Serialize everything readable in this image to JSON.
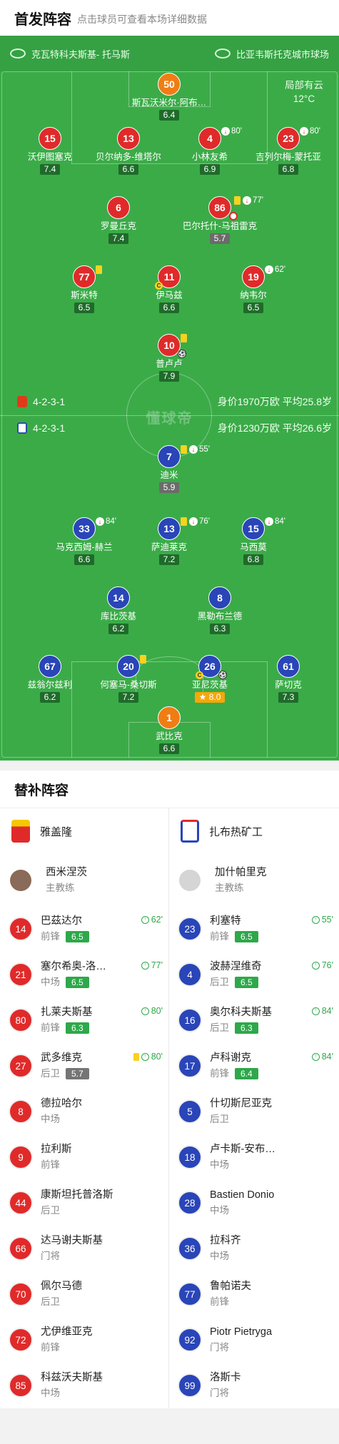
{
  "header": {
    "title": "首发阵容",
    "subtitle": "点击球员可查看本场详细数据"
  },
  "venue": {
    "home_stadium": "克瓦特科夫斯基- 托马斯",
    "away_stadium": "比亚韦斯托克城市球场"
  },
  "weather": {
    "condition": "局部有云",
    "temp": "12°C"
  },
  "watermark": "懂球帝",
  "home_team": {
    "formation": "4-2-3-1",
    "value": "身价1970万欧 平均25.8岁",
    "color": "#e02a2a"
  },
  "away_team": {
    "formation": "4-2-3-1",
    "value": "身价1230万欧 平均26.6岁",
    "color": "#2945b8"
  },
  "home_players": [
    {
      "num": "50",
      "name": "斯瓦沃米尔·阿布…",
      "rating": "6.4"
    },
    {
      "num": "15",
      "name": "沃伊图塞克",
      "rating": "7.4"
    },
    {
      "num": "13",
      "name": "贝尔纳多-维塔尔",
      "rating": "6.6"
    },
    {
      "num": "4",
      "name": "小林友希",
      "rating": "6.9",
      "sub": "80'"
    },
    {
      "num": "23",
      "name": "吉列尔梅-蒙托亚",
      "rating": "6.8",
      "sub": "80'"
    },
    {
      "num": "6",
      "name": "罗曼丘克",
      "rating": "7.4"
    },
    {
      "num": "86",
      "name": "巴尔托什-马祖雷克",
      "rating": "5.7",
      "sub": "77'"
    },
    {
      "num": "77",
      "name": "斯米特",
      "rating": "6.5"
    },
    {
      "num": "11",
      "name": "伊马兹",
      "rating": "6.6"
    },
    {
      "num": "19",
      "name": "纳韦尔",
      "rating": "6.5",
      "sub": "62'"
    },
    {
      "num": "10",
      "name": "普卢卢",
      "rating": "7.9"
    }
  ],
  "away_players": [
    {
      "num": "7",
      "name": "迪米",
      "rating": "5.9",
      "sub": "55'"
    },
    {
      "num": "33",
      "name": "马克西姆-赫兰",
      "rating": "6.6",
      "sub": "84'"
    },
    {
      "num": "13",
      "name": "萨迪莱克",
      "rating": "7.2",
      "sub": "76'"
    },
    {
      "num": "15",
      "name": "马西莫",
      "rating": "6.8",
      "sub": "84'"
    },
    {
      "num": "14",
      "name": "库比茨基",
      "rating": "6.2"
    },
    {
      "num": "8",
      "name": "黑勒布兰德",
      "rating": "6.3"
    },
    {
      "num": "67",
      "name": "兹翁尔兹利",
      "rating": "6.2"
    },
    {
      "num": "20",
      "name": "何塞马-桑切斯",
      "rating": "7.2"
    },
    {
      "num": "26",
      "name": "亚尼茨基",
      "rating": "8.0"
    },
    {
      "num": "61",
      "name": "萨切克",
      "rating": "7.3"
    },
    {
      "num": "1",
      "name": "武比克",
      "rating": "6.6"
    }
  ],
  "bench_section": {
    "title": "替补阵容"
  },
  "bench_home": {
    "team": "雅盖隆",
    "coach_name": "西米涅茨",
    "coach_role": "主教练",
    "players": [
      {
        "num": "14",
        "name": "巴茲达尔",
        "pos": "前锋",
        "rating": "6.5",
        "sub": "62'"
      },
      {
        "num": "21",
        "name": "塞尔希奥-洛…",
        "pos": "中场",
        "rating": "6.5",
        "sub": "77'"
      },
      {
        "num": "80",
        "name": "扎莱夫斯基",
        "pos": "前锋",
        "rating": "6.3",
        "sub": "80'"
      },
      {
        "num": "27",
        "name": "武多维克",
        "pos": "后卫",
        "rating": "5.7",
        "sub": "80'"
      },
      {
        "num": "8",
        "name": "德拉哈尔",
        "pos": "中场"
      },
      {
        "num": "9",
        "name": "拉利斯",
        "pos": "前锋"
      },
      {
        "num": "44",
        "name": "康斯坦托普洛斯",
        "pos": "后卫"
      },
      {
        "num": "66",
        "name": "达马谢夫斯基",
        "pos": "门将"
      },
      {
        "num": "70",
        "name": "佩尔马德",
        "pos": "后卫"
      },
      {
        "num": "72",
        "name": "尤伊维亚克",
        "pos": "前锋"
      },
      {
        "num": "85",
        "name": "科兹沃夫斯基",
        "pos": "中场"
      }
    ]
  },
  "bench_away": {
    "team": "扎布热矿工",
    "coach_name": "加什帕里克",
    "coach_role": "主教练",
    "players": [
      {
        "num": "23",
        "name": "利塞特",
        "pos": "前锋",
        "rating": "6.5",
        "sub": "55'"
      },
      {
        "num": "4",
        "name": "波赫涅维奇",
        "pos": "后卫",
        "rating": "6.5",
        "sub": "76'"
      },
      {
        "num": "16",
        "name": "奥尔科夫斯基",
        "pos": "后卫",
        "rating": "6.3",
        "sub": "84'"
      },
      {
        "num": "17",
        "name": "卢科谢克",
        "pos": "前锋",
        "rating": "6.4",
        "sub": "84'"
      },
      {
        "num": "5",
        "name": "什切斯尼亚克",
        "pos": "后卫"
      },
      {
        "num": "18",
        "name": "卢卡斯-安布…",
        "pos": "中场"
      },
      {
        "num": "28",
        "name": "Bastien Donio",
        "pos": "中场"
      },
      {
        "num": "36",
        "name": "拉科齐",
        "pos": "中场"
      },
      {
        "num": "77",
        "name": "鲁帕诺夫",
        "pos": "前锋"
      },
      {
        "num": "92",
        "name": "Piotr Pietryga",
        "pos": "门将"
      },
      {
        "num": "99",
        "name": "洛斯卡",
        "pos": "门将"
      }
    ]
  }
}
